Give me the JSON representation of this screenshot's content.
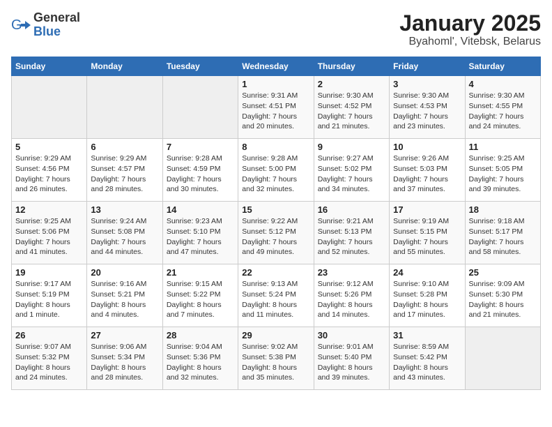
{
  "header": {
    "logo_general": "General",
    "logo_blue": "Blue",
    "title": "January 2025",
    "subtitle": "Byahoml', Vitebsk, Belarus"
  },
  "weekdays": [
    "Sunday",
    "Monday",
    "Tuesday",
    "Wednesday",
    "Thursday",
    "Friday",
    "Saturday"
  ],
  "weeks": [
    [
      {
        "day": "",
        "info": ""
      },
      {
        "day": "",
        "info": ""
      },
      {
        "day": "",
        "info": ""
      },
      {
        "day": "1",
        "info": "Sunrise: 9:31 AM\nSunset: 4:51 PM\nDaylight: 7 hours\nand 20 minutes."
      },
      {
        "day": "2",
        "info": "Sunrise: 9:30 AM\nSunset: 4:52 PM\nDaylight: 7 hours\nand 21 minutes."
      },
      {
        "day": "3",
        "info": "Sunrise: 9:30 AM\nSunset: 4:53 PM\nDaylight: 7 hours\nand 23 minutes."
      },
      {
        "day": "4",
        "info": "Sunrise: 9:30 AM\nSunset: 4:55 PM\nDaylight: 7 hours\nand 24 minutes."
      }
    ],
    [
      {
        "day": "5",
        "info": "Sunrise: 9:29 AM\nSunset: 4:56 PM\nDaylight: 7 hours\nand 26 minutes."
      },
      {
        "day": "6",
        "info": "Sunrise: 9:29 AM\nSunset: 4:57 PM\nDaylight: 7 hours\nand 28 minutes."
      },
      {
        "day": "7",
        "info": "Sunrise: 9:28 AM\nSunset: 4:59 PM\nDaylight: 7 hours\nand 30 minutes."
      },
      {
        "day": "8",
        "info": "Sunrise: 9:28 AM\nSunset: 5:00 PM\nDaylight: 7 hours\nand 32 minutes."
      },
      {
        "day": "9",
        "info": "Sunrise: 9:27 AM\nSunset: 5:02 PM\nDaylight: 7 hours\nand 34 minutes."
      },
      {
        "day": "10",
        "info": "Sunrise: 9:26 AM\nSunset: 5:03 PM\nDaylight: 7 hours\nand 37 minutes."
      },
      {
        "day": "11",
        "info": "Sunrise: 9:25 AM\nSunset: 5:05 PM\nDaylight: 7 hours\nand 39 minutes."
      }
    ],
    [
      {
        "day": "12",
        "info": "Sunrise: 9:25 AM\nSunset: 5:06 PM\nDaylight: 7 hours\nand 41 minutes."
      },
      {
        "day": "13",
        "info": "Sunrise: 9:24 AM\nSunset: 5:08 PM\nDaylight: 7 hours\nand 44 minutes."
      },
      {
        "day": "14",
        "info": "Sunrise: 9:23 AM\nSunset: 5:10 PM\nDaylight: 7 hours\nand 47 minutes."
      },
      {
        "day": "15",
        "info": "Sunrise: 9:22 AM\nSunset: 5:12 PM\nDaylight: 7 hours\nand 49 minutes."
      },
      {
        "day": "16",
        "info": "Sunrise: 9:21 AM\nSunset: 5:13 PM\nDaylight: 7 hours\nand 52 minutes."
      },
      {
        "day": "17",
        "info": "Sunrise: 9:19 AM\nSunset: 5:15 PM\nDaylight: 7 hours\nand 55 minutes."
      },
      {
        "day": "18",
        "info": "Sunrise: 9:18 AM\nSunset: 5:17 PM\nDaylight: 7 hours\nand 58 minutes."
      }
    ],
    [
      {
        "day": "19",
        "info": "Sunrise: 9:17 AM\nSunset: 5:19 PM\nDaylight: 8 hours\nand 1 minute."
      },
      {
        "day": "20",
        "info": "Sunrise: 9:16 AM\nSunset: 5:21 PM\nDaylight: 8 hours\nand 4 minutes."
      },
      {
        "day": "21",
        "info": "Sunrise: 9:15 AM\nSunset: 5:22 PM\nDaylight: 8 hours\nand 7 minutes."
      },
      {
        "day": "22",
        "info": "Sunrise: 9:13 AM\nSunset: 5:24 PM\nDaylight: 8 hours\nand 11 minutes."
      },
      {
        "day": "23",
        "info": "Sunrise: 9:12 AM\nSunset: 5:26 PM\nDaylight: 8 hours\nand 14 minutes."
      },
      {
        "day": "24",
        "info": "Sunrise: 9:10 AM\nSunset: 5:28 PM\nDaylight: 8 hours\nand 17 minutes."
      },
      {
        "day": "25",
        "info": "Sunrise: 9:09 AM\nSunset: 5:30 PM\nDaylight: 8 hours\nand 21 minutes."
      }
    ],
    [
      {
        "day": "26",
        "info": "Sunrise: 9:07 AM\nSunset: 5:32 PM\nDaylight: 8 hours\nand 24 minutes."
      },
      {
        "day": "27",
        "info": "Sunrise: 9:06 AM\nSunset: 5:34 PM\nDaylight: 8 hours\nand 28 minutes."
      },
      {
        "day": "28",
        "info": "Sunrise: 9:04 AM\nSunset: 5:36 PM\nDaylight: 8 hours\nand 32 minutes."
      },
      {
        "day": "29",
        "info": "Sunrise: 9:02 AM\nSunset: 5:38 PM\nDaylight: 8 hours\nand 35 minutes."
      },
      {
        "day": "30",
        "info": "Sunrise: 9:01 AM\nSunset: 5:40 PM\nDaylight: 8 hours\nand 39 minutes."
      },
      {
        "day": "31",
        "info": "Sunrise: 8:59 AM\nSunset: 5:42 PM\nDaylight: 8 hours\nand 43 minutes."
      },
      {
        "day": "",
        "info": ""
      }
    ]
  ]
}
